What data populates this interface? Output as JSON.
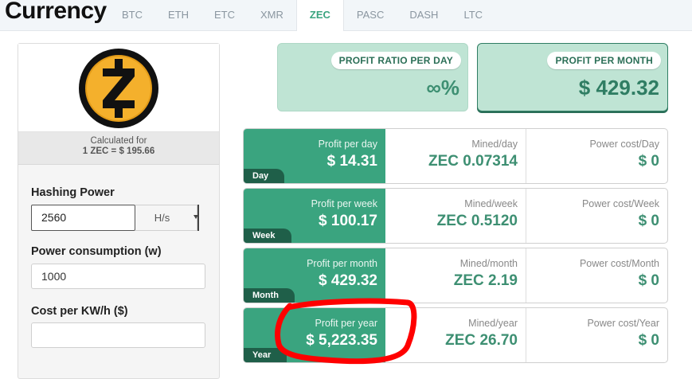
{
  "header": {
    "title": "Currency",
    "tabs": [
      {
        "label": "BTC"
      },
      {
        "label": "ETH"
      },
      {
        "label": "ETC"
      },
      {
        "label": "XMR"
      },
      {
        "label": "ZEC",
        "active": true
      },
      {
        "label": "PASC"
      },
      {
        "label": "DASH"
      },
      {
        "label": "LTC"
      }
    ]
  },
  "coin": {
    "icon": "zcash-logo-icon",
    "calc_line1": "Calculated for",
    "calc_line2": "1 ZEC = $ 195.66"
  },
  "form": {
    "hashing_label": "Hashing Power",
    "hashing_value": "2560",
    "hashing_unit": "H/s",
    "power_label": "Power consumption (w)",
    "power_value": "1000",
    "cost_label": "Cost per KW/h ($)",
    "cost_value": ""
  },
  "summary": {
    "ratio_label": "PROFIT RATIO PER DAY",
    "ratio_value": "∞%",
    "month_label": "PROFIT PER MONTH",
    "month_value": "$ 429.32"
  },
  "rows": [
    {
      "period": "Day",
      "profit_label": "Profit per day",
      "profit": "$ 14.31",
      "mined_label": "Mined/day",
      "mined": "ZEC 0.07314",
      "cost_label": "Power cost/Day",
      "cost": "$ 0"
    },
    {
      "period": "Week",
      "profit_label": "Profit per week",
      "profit": "$ 100.17",
      "mined_label": "Mined/week",
      "mined": "ZEC 0.5120",
      "cost_label": "Power cost/Week",
      "cost": "$ 0"
    },
    {
      "period": "Month",
      "profit_label": "Profit per month",
      "profit": "$ 429.32",
      "mined_label": "Mined/month",
      "mined": "ZEC 2.19",
      "cost_label": "Power cost/Month",
      "cost": "$ 0"
    },
    {
      "period": "Year",
      "profit_label": "Profit per year",
      "profit": "$ 5,223.35",
      "mined_label": "Mined/year",
      "mined": "ZEC 26.70",
      "cost_label": "Power cost/Year",
      "cost": "$ 0"
    }
  ],
  "colors": {
    "accent": "#3aa47f",
    "accent_dark": "#1f5f49",
    "summary_bg": "#bfe4d4",
    "annotation": "#ff0000"
  }
}
